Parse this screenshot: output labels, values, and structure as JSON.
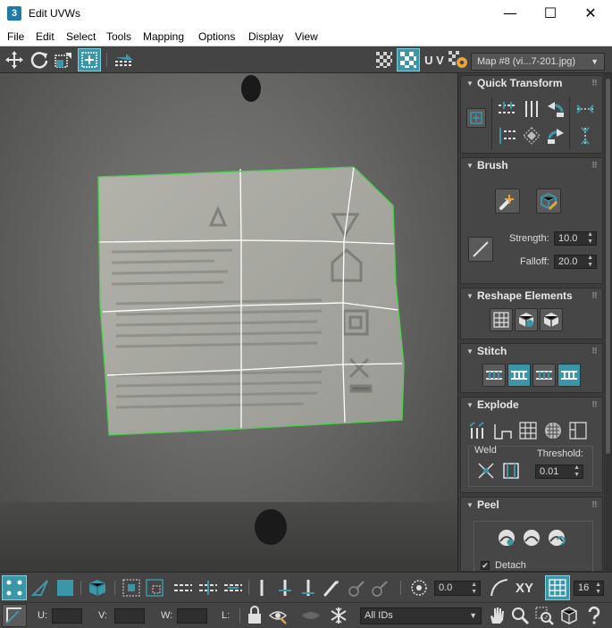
{
  "window": {
    "app_icon_text": "3",
    "title": "Edit UVWs",
    "minimize_glyph": "—",
    "maximize_glyph": "☐",
    "close_glyph": "✕"
  },
  "menu": [
    "File",
    "Edit",
    "Select",
    "Tools",
    "Mapping",
    "Options",
    "Display",
    "View"
  ],
  "toolbar": {
    "uv_label": "U V",
    "map_selector": "Map #8 (vi...7-201.jpg)",
    "map_selector_arrow": "▼"
  },
  "rollouts": {
    "quick_transform": "Quick Transform",
    "brush": {
      "title": "Brush",
      "strength_label": "Strength:",
      "strength_value": "10.0",
      "falloff_label": "Falloff:",
      "falloff_value": "20.0"
    },
    "reshape": "Reshape Elements",
    "stitch": "Stitch",
    "explode": {
      "title": "Explode",
      "weld_label": "Weld",
      "threshold_label": "Threshold:",
      "threshold_value": "0.01"
    },
    "peel": {
      "title": "Peel",
      "detach_label": "Detach",
      "detach_checked": true
    },
    "caret": "▼",
    "grip": "⠿"
  },
  "bottom": {
    "rotate_value": "0.0",
    "xy_label": "XY",
    "grid_value": "16",
    "u_label": "U:",
    "v_label": "V:",
    "w_label": "W:",
    "l_label": "L:",
    "u_value": "",
    "v_value": "",
    "w_value": "",
    "id_filter": "All IDs",
    "id_filter_arrow": "▼"
  },
  "colors": {
    "accent": "#3b97a7",
    "mesh_border": "#4bd14b",
    "grid_lines": "#ffffff",
    "panel_bg": "#3c3c3c"
  }
}
